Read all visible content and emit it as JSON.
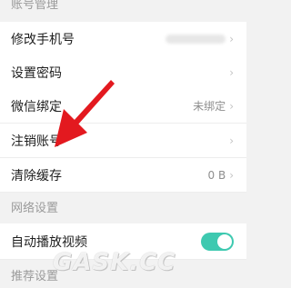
{
  "sections": {
    "account": "账号管理",
    "network": "网络设置",
    "recommend": "推荐设置"
  },
  "rows": {
    "change_phone": "修改手机号",
    "set_password": "设置密码",
    "wechat_bind": "微信绑定",
    "wechat_bind_value": "未绑定",
    "cancel_account": "注销账号",
    "clear_cache": "清除缓存",
    "clear_cache_value": "0 B",
    "autoplay_video": "自动播放视频",
    "autoplay_enabled": true
  },
  "icons": {
    "row_chevron": "chevron-right-icon",
    "annotation": "red-arrow-icon"
  },
  "colors": {
    "toggle_on": "#3ec9b0",
    "arrow": "#e3191f"
  },
  "watermark": "GASK.CC"
}
